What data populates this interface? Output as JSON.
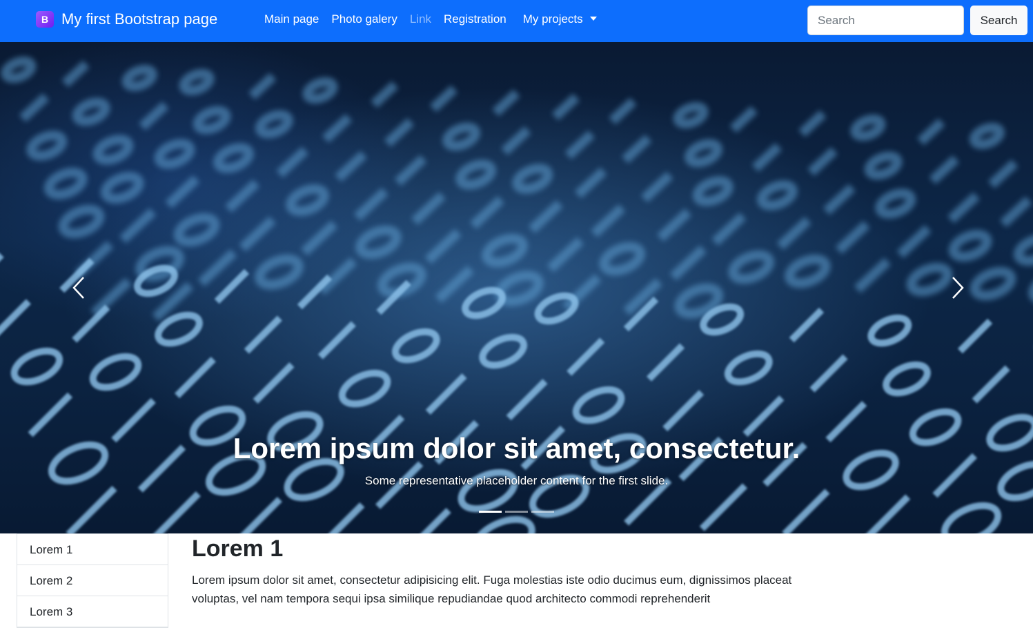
{
  "navbar": {
    "brand_logo": "B",
    "brand_text": "My first Bootstrap page",
    "links": [
      {
        "label": "Main page",
        "disabled": false
      },
      {
        "label": "Photo galery",
        "disabled": false
      },
      {
        "label": "Link",
        "disabled": true
      },
      {
        "label": "Registration",
        "disabled": false
      }
    ],
    "dropdown_label": "My projects",
    "search": {
      "placeholder": "Search",
      "value": "",
      "button_label": "Search"
    }
  },
  "carousel": {
    "caption_title": "Lorem ipsum dolor sit amet, consectetur.",
    "caption_text": "Some representative placeholder content for the first slide.",
    "indicators": [
      true,
      false,
      false
    ],
    "prev_icon": "chevron-left-icon",
    "next_icon": "chevron-right-icon",
    "image_subject": "binary digits 0 and 1"
  },
  "sidebar": {
    "items": [
      {
        "label": "Lorem 1"
      },
      {
        "label": "Lorem 2"
      },
      {
        "label": "Lorem 3"
      }
    ]
  },
  "main": {
    "title": "Lorem 1",
    "text": "Lorem ipsum dolor sit amet, consectetur adipisicing elit. Fuga molestias iste odio ducimus eum, dignissimos placeat voluptas, vel nam tempora sequi ipsa similique repudiandae quod architecto commodi reprehenderit"
  },
  "colors": {
    "navbar_bg": "#0d6efd",
    "brand_logo_bg": "#7c2ef5",
    "text": "#212529",
    "border": "#dee2e6"
  }
}
